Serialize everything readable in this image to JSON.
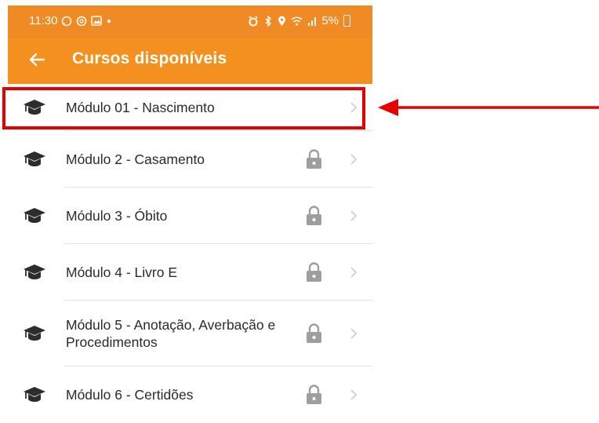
{
  "status_bar": {
    "time": "11:30",
    "battery_text": "5%",
    "left_icons": [
      "whatsapp-icon",
      "instagram-icon",
      "gallery-icon",
      "dot-icon"
    ],
    "right_icons": [
      "alarm-icon",
      "bluetooth-icon",
      "location-icon",
      "wifi-icon",
      "signal-icon",
      "battery-icon"
    ]
  },
  "appbar": {
    "title": "Cursos disponíveis",
    "back_icon": "arrow-left-icon"
  },
  "colors": {
    "statusbar": "#f08a24",
    "appbar": "#f39020",
    "highlight": "#e60000",
    "icon_dark": "#2d2d2d",
    "lock": "#9e9e9e",
    "chevron": "#c7c7c7"
  },
  "courses": [
    {
      "label": "Módulo 01 - Nascimento",
      "locked": false
    },
    {
      "label": "Módulo 2 - Casamento",
      "locked": true
    },
    {
      "label": "Módulo 3 - Óbito",
      "locked": true
    },
    {
      "label": "Módulo 4 - Livro E",
      "locked": true
    },
    {
      "label": "Módulo 5 - Anotação, Averbação e Procedimentos",
      "locked": true
    },
    {
      "label": "Módulo 6 - Certidões",
      "locked": true
    }
  ]
}
